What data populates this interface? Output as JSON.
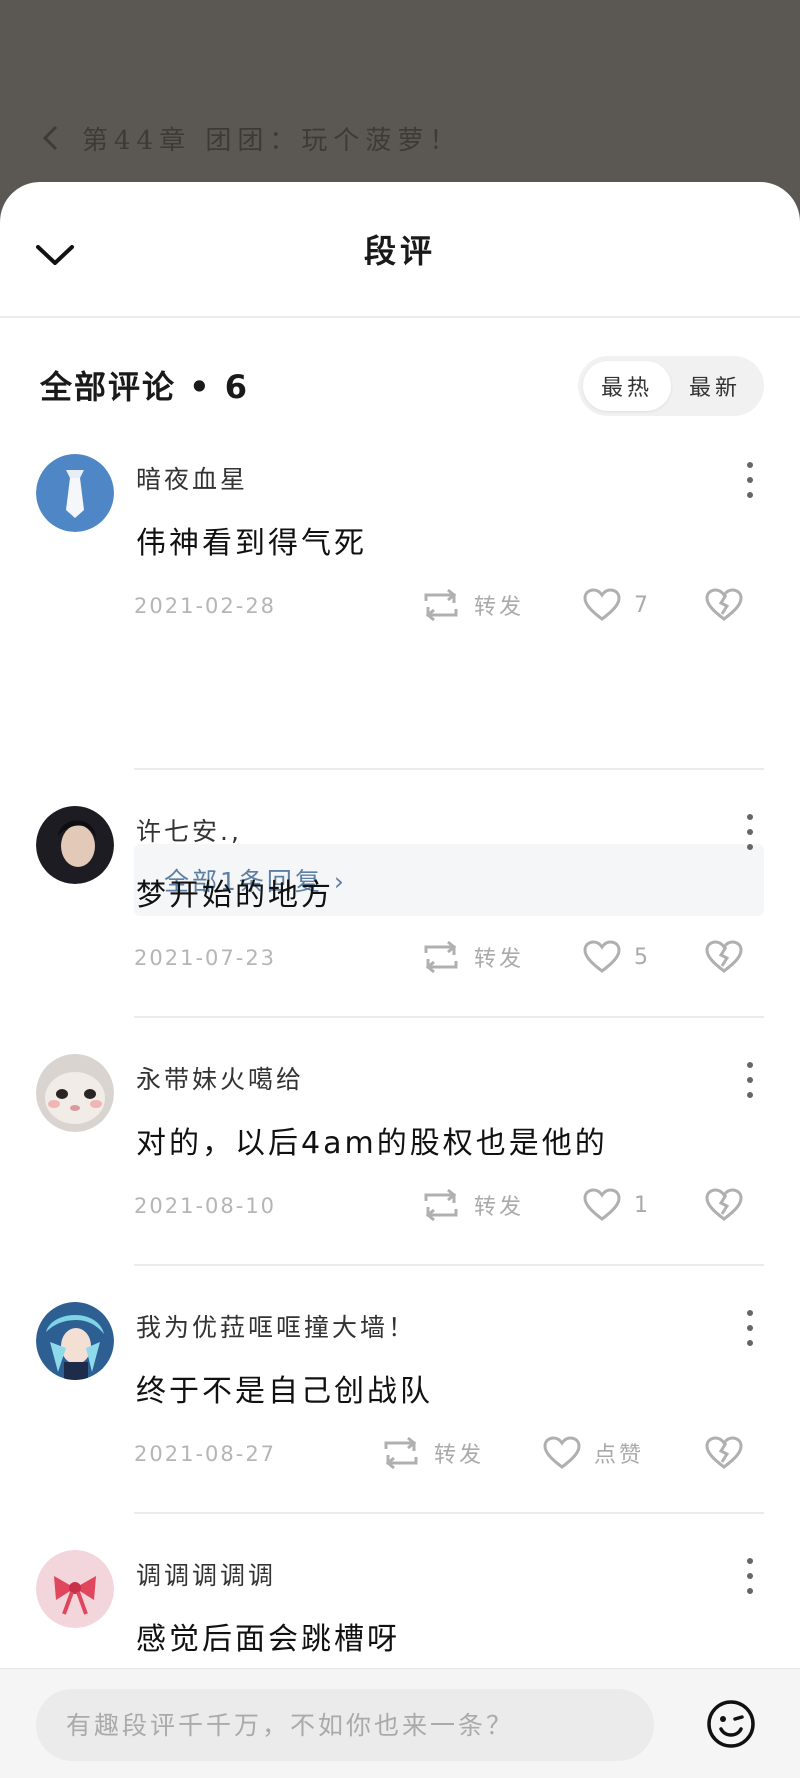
{
  "reader": {
    "chapter_title": "第44章 团团：玩个菠萝！"
  },
  "sheet": {
    "title": "段评"
  },
  "list": {
    "count_title": "全部评论 • 6",
    "sort_options": [
      "最热",
      "最新"
    ],
    "active_sort": "最热"
  },
  "comments": [
    {
      "name": "暗夜血星",
      "text": "伟神看到得气死",
      "date": "2021-02-28",
      "repost_label": "转发",
      "like_label": "7",
      "avatar_color": "#4f87c6"
    },
    {
      "name": "许七安.,",
      "text": "梦开始的地方",
      "date": "2021-07-23",
      "repost_label": "转发",
      "like_label": "5",
      "avatar_color": "#1c1c22"
    },
    {
      "name": "永带妹火噶给",
      "text": "对的，以后4am的股权也是他的",
      "date": "2021-08-10",
      "repost_label": "转发",
      "like_label": "1",
      "avatar_color": "#d9d4cf"
    },
    {
      "name": "我为优菈哐哐撞大墙！",
      "text": "终于不是自己创战队",
      "date": "2021-08-27",
      "repost_label": "转发",
      "like_label": "点赞",
      "avatar_color": "#2d5f93"
    },
    {
      "name": "调调调调调",
      "text": "感觉后面会跳槽呀",
      "date": "",
      "repost_label": "",
      "like_label": "",
      "avatar_color": "#f3d5dc"
    }
  ],
  "replies": {
    "label": "全部1条回复 ›"
  },
  "input": {
    "placeholder": "有趣段评千千万，不如你也来一条？"
  },
  "icons": {
    "collapse": "chevron-down-icon",
    "back": "chevron-left-icon",
    "more": "more-vertical-icon",
    "repost": "repost-icon",
    "like": "heart-icon",
    "dislike": "broken-heart-icon",
    "emoji": "smile-icon"
  }
}
